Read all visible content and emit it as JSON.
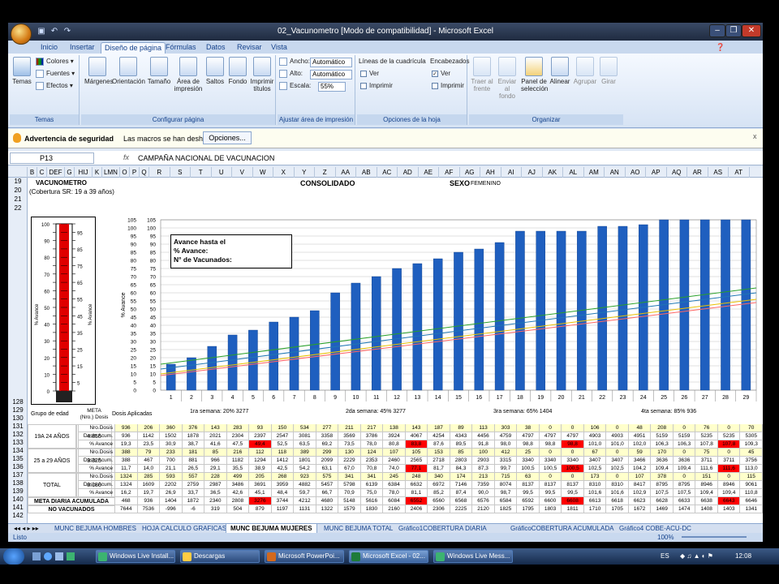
{
  "window": {
    "title": "02_Vacunometro  [Modo de compatibilidad] - Microsoft Excel",
    "controls": [
      "–",
      "❐",
      "✕"
    ]
  },
  "ribbon_tabs": [
    "Inicio",
    "Insertar",
    "Diseño de página",
    "Fórmulas",
    "Datos",
    "Revisar",
    "Vista"
  ],
  "active_tab": "Diseño de página",
  "ribbon": {
    "temas": {
      "label": "Temas",
      "colores": "Colores",
      "fuentes": "Fuentes",
      "efectos": "Efectos",
      "temas_btn": "Temas"
    },
    "configurar": {
      "label": "Configurar página",
      "margenes": "Márgenes",
      "orientacion": "Orientación",
      "tamano": "Tamaño",
      "area_impresion_1": "Área de",
      "area_impresion_2": "impresión",
      "saltos": "Saltos",
      "fondo": "Fondo",
      "imprimir_titulos_1": "Imprimir",
      "imprimir_titulos_2": "títulos"
    },
    "ajustar": {
      "label": "Ajustar área de impresión",
      "ancho": "Ancho:",
      "alto": "Alto:",
      "escala": "Escala:",
      "ancho_val": "Automático",
      "alto_val": "Automático",
      "escala_val": "55%"
    },
    "opciones": {
      "label": "Opciones de la hoja",
      "lineas": "Líneas de la cuadrícula",
      "encabezados": "Encabezados",
      "ver": "Ver",
      "imprimir": "Imprimir"
    },
    "organizar": {
      "label": "Organizar",
      "traer_1": "Traer al",
      "traer_2": "frente",
      "enviar_1": "Enviar al",
      "enviar_2": "fondo",
      "panel_1": "Panel de",
      "panel_2": "selección",
      "alinear": "Alinear",
      "agrupar": "Agrupar",
      "girar": "Girar"
    }
  },
  "security": {
    "title": "Advertencia de seguridad",
    "message": "Las macros se han deshabilitado.",
    "button": "Opciones...",
    "close": "x"
  },
  "formula_bar": {
    "name_box": "P13",
    "fx": "fx",
    "content": "CAMPAÑA NACIONAL DE VACUNACION"
  },
  "column_headers": [
    "B",
    "C",
    "DEF",
    "G",
    "HIJ",
    "K",
    "LMN",
    "O",
    "P",
    "Q",
    "R",
    "S",
    "T",
    "U",
    "V",
    "W",
    "X",
    "Y",
    "Z",
    "AA",
    "AB",
    "AC",
    "AD",
    "AE",
    "AF",
    "AG",
    "AH",
    "AI",
    "AJ",
    "AK",
    "AL",
    "AM",
    "AN",
    "AO",
    "AP",
    "AQ",
    "AR",
    "AS",
    "AT"
  ],
  "row_headers": [
    "19",
    "20",
    "21",
    "22",
    "128",
    "129",
    "130",
    "131",
    "132",
    "133",
    "134",
    "135",
    "136",
    "137",
    "138",
    "139",
    "140",
    "141",
    "142"
  ],
  "sheet": {
    "vacunometro_title": "VACUNOMETRO",
    "cobertura": "(Cobertura SR: 19 a 39 años)",
    "consolidado": "CONSOLIDADO",
    "sexo": "SEXO",
    "sexo_val": "FEMENINO",
    "thermo_left_ticks": [
      "100",
      "90",
      "80",
      "70",
      "60",
      "50",
      "40",
      "30",
      "20",
      "10",
      "0"
    ],
    "thermo_right_ticks": [
      "95",
      "85",
      "75",
      "65",
      "55",
      "45",
      "35",
      "25",
      "15",
      "5"
    ],
    "thermo_axis_label": "% Avance",
    "annotation_1": "Avance hasta el",
    "annotation_2": "% Avance:",
    "annotation_3": "N° de Vacunados:",
    "week1": "1ra semana: 20%  3277",
    "week2": "2da semana: 45%  3277",
    "week3": "3ra semana: 65%  1404",
    "week4": "4ta semana: 85% 936",
    "grupo_edad": "Grupo de edad",
    "meta_1": "META",
    "meta_2": "(Nro.) Dosis",
    "dosis_aplicadas": "Dosis Aplicadas",
    "meta_diaria": "META DIARIA ACUMULADA",
    "no_vacunados": "NO VACUNADOS"
  },
  "chart_data": {
    "type": "bar",
    "categories": [
      "1",
      "2",
      "3",
      "4",
      "5",
      "6",
      "7",
      "8",
      "9",
      "10",
      "11",
      "12",
      "13",
      "14",
      "15",
      "16",
      "17",
      "18",
      "19",
      "20",
      "21",
      "22",
      "23",
      "24",
      "25",
      "26",
      "27",
      "28",
      "29"
    ],
    "values": [
      16,
      20,
      27,
      34,
      37,
      42,
      45,
      49,
      60,
      66,
      70,
      75,
      78,
      81,
      85,
      87,
      91,
      98,
      98,
      98,
      98,
      101,
      101,
      102,
      106,
      106,
      107,
      108,
      109
    ],
    "ylabel": "% Avance",
    "ylim": [
      0,
      105
    ],
    "yticks": [
      0,
      5,
      10,
      15,
      20,
      25,
      30,
      35,
      40,
      45,
      50,
      55,
      60,
      65,
      70,
      75,
      80,
      85,
      90,
      95,
      100,
      105
    ],
    "lines": [
      "#2aa02a",
      "#1f77b4",
      "#e8c000",
      "#ff6666"
    ],
    "bar_color": "#1f5fbf"
  },
  "table": {
    "groups": [
      {
        "name": "19A 24 AÑOS",
        "meta": "4.855",
        "rows": [
          {
            "label": "Nro.Dosis diar.",
            "values": [
              "936",
              "206",
              "360",
              "376",
              "143",
              "283",
              "93",
              "150",
              "534",
              "277",
              "211",
              "217",
              "138",
              "143",
              "187",
              "89",
              "113",
              "303",
              "38",
              "0",
              "0",
              "106",
              "0",
              "48",
              "208",
              "0",
              "76",
              "0",
              "70"
            ]
          },
          {
            "label": "Dosis Acum.",
            "values": [
              "936",
              "1142",
              "1502",
              "1878",
              "2021",
              "2304",
              "2397",
              "2547",
              "3081",
              "3358",
              "3569",
              "3786",
              "3924",
              "4067",
              "4254",
              "4343",
              "4456",
              "4759",
              "4797",
              "4797",
              "4797",
              "4903",
              "4903",
              "4951",
              "5159",
              "5159",
              "5235",
              "5235",
              "5305"
            ]
          },
          {
            "label": "% Avance",
            "values": [
              "19,3",
              "23,5",
              "30,9",
              "38,7",
              "41,6",
              "47,5",
              "49,4",
              "52,5",
              "63,5",
              "69,2",
              "73,5",
              "78,0",
              "80,8",
              "83,8",
              "87,6",
              "89,5",
              "91,8",
              "98,0",
              "98,8",
              "98,8",
              "98,8",
              "101,0",
              "101,0",
              "102,0",
              "106,3",
              "106,3",
              "107,8",
              "107,8",
              "109,3"
            ],
            "highlight": [
              6,
              13,
              20,
              27
            ]
          }
        ]
      },
      {
        "name": "25 a 29 AÑOS",
        "meta": "3.325",
        "rows": [
          {
            "label": "Nro.Dosis diar.",
            "values": [
              "388",
              "79",
              "233",
              "181",
              "85",
              "216",
              "112",
              "118",
              "389",
              "299",
              "130",
              "124",
              "107",
              "105",
              "153",
              "85",
              "100",
              "412",
              "25",
              "0",
              "0",
              "67",
              "0",
              "59",
              "170",
              "0",
              "75",
              "0",
              "45"
            ]
          },
          {
            "label": "Dosis Acum.",
            "values": [
              "388",
              "467",
              "700",
              "881",
              "966",
              "1182",
              "1294",
              "1412",
              "1801",
              "2099",
              "2229",
              "2353",
              "2460",
              "2565",
              "2718",
              "2803",
              "2903",
              "3315",
              "3340",
              "3340",
              "3340",
              "3407",
              "3407",
              "3466",
              "3636",
              "3636",
              "3711",
              "3711",
              "3756"
            ]
          },
          {
            "label": "% Avance",
            "values": [
              "11,7",
              "14,0",
              "21,1",
              "26,5",
              "29,1",
              "35,5",
              "38,9",
              "42,5",
              "54,2",
              "63,1",
              "67,0",
              "70,8",
              "74,0",
              "77,1",
              "81,7",
              "84,3",
              "87,3",
              "99,7",
              "100,5",
              "100,5",
              "100,5",
              "102,5",
              "102,5",
              "104,2",
              "109,4",
              "109,4",
              "111,6",
              "111,6",
              "113,0"
            ],
            "highlight": [
              13,
              20,
              27
            ]
          }
        ]
      },
      {
        "name": "TOTAL",
        "meta": "8.180",
        "rows": [
          {
            "label": "Nro.Dosis diar.",
            "values": [
              "1324",
              "285",
              "593",
              "557",
              "228",
              "499",
              "205",
              "268",
              "923",
              "575",
              "341",
              "341",
              "245",
              "248",
              "340",
              "174",
              "213",
              "715",
              "63",
              "0",
              "0",
              "173",
              "0",
              "107",
              "378",
              "0",
              "151",
              "0",
              "115"
            ]
          },
          {
            "label": "Dosis Acum.",
            "values": [
              "1324",
              "1609",
              "2202",
              "2759",
              "2987",
              "3486",
              "3691",
              "3959",
              "4882",
              "5457",
              "5798",
              "6139",
              "6384",
              "6632",
              "6972",
              "7146",
              "7359",
              "8074",
              "8137",
              "8137",
              "8137",
              "8310",
              "8310",
              "8417",
              "8795",
              "8795",
              "8946",
              "8946",
              "9061"
            ]
          },
          {
            "label": "% Avance",
            "values": [
              "16,2",
              "19,7",
              "26,9",
              "33,7",
              "36,5",
              "42,6",
              "45,1",
              "48,4",
              "59,7",
              "66,7",
              "70,9",
              "75,0",
              "78,0",
              "81,1",
              "85,2",
              "87,4",
              "90,0",
              "98,7",
              "99,5",
              "99,5",
              "99,5",
              "101,6",
              "101,6",
              "102,9",
              "107,5",
              "107,5",
              "109,4",
              "109,4",
              "110,8"
            ]
          }
        ]
      }
    ],
    "meta_diaria": [
      "468",
      "936",
      "1404",
      "1872",
      "2340",
      "2808",
      "3276",
      "3744",
      "4212",
      "4680",
      "5148",
      "5616",
      "6084",
      "6552",
      "6560",
      "6568",
      "6576",
      "6584",
      "6592",
      "6600",
      "6608",
      "6613",
      "6618",
      "6623",
      "6628",
      "6633",
      "6638",
      "6643",
      "6646"
    ],
    "meta_highlight": [
      6,
      13,
      20,
      27
    ],
    "no_vacunados": [
      "7644",
      "7536",
      "-996",
      "-6",
      "319",
      "504",
      "879",
      "1197",
      "1131",
      "1322",
      "1579",
      "1830",
      "2160",
      "2406",
      "2306",
      "2225",
      "2120",
      "1825",
      "1795",
      "1803",
      "1811",
      "1710",
      "1705",
      "1672",
      "1469",
      "1474",
      "1408",
      "1403",
      "1341"
    ]
  },
  "sheet_tabs": [
    "MUNC BEJUMA  HOMBRES",
    "HOJA CALCULO GRAFICAS",
    "MUNC BEJUMA MUJERES",
    "MUNC BEJUMA TOTAL",
    "Gráfico1COBERTURA DIARIA",
    "GráficoCOBERTURA ACUMULADA",
    "Gráfico4 COBE-ACU-DC"
  ],
  "active_sheet": "MUNC BEJUMA MUJERES",
  "status": {
    "ready": "Listo",
    "zoom": "100%"
  },
  "taskbar": {
    "items": [
      "Windows Live Install...",
      "Descargas",
      "Microsoft PowerPoi...",
      "Microsoft Excel - 02...",
      "Windows Live Mess..."
    ],
    "active": 3,
    "lang": "ES",
    "clock": "12:08"
  },
  "colors": {
    "accent": "#1f5fbf",
    "thermo_red": "#e00000",
    "highlight_red": "#ff0000",
    "highlight_yellow": "#ffff66"
  }
}
